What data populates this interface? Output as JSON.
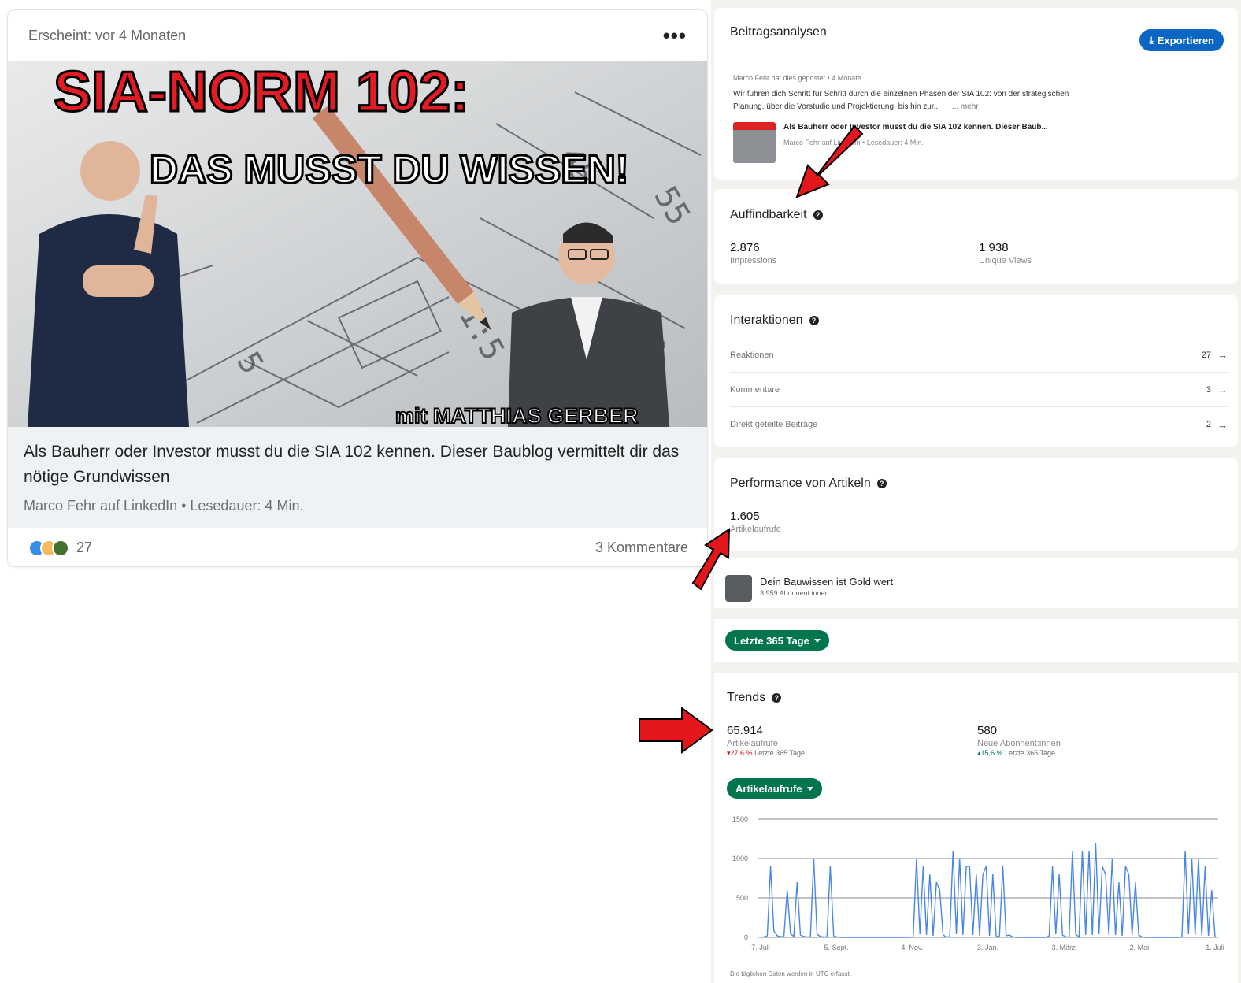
{
  "post": {
    "meta": "Erscheint: vor 4 Monaten",
    "more_label": "•••",
    "image": {
      "headline": "SIA-NORM 102:",
      "subheadline": "DAS MUSST DU WISSEN!",
      "byline": "mit MATTHIAS GERBER"
    },
    "title": "Als Bauherr oder Investor musst du die SIA 102 kennen. Dieser Baublog vermittelt dir das nötige Grundwissen",
    "source": "Marco Fehr auf LinkedIn • Lesedauer: 4 Min.",
    "reactions_count": "27",
    "comments": "3 Kommentare"
  },
  "analytics": {
    "title": "Beitragsanalysen",
    "export_label": "Exportieren",
    "preview": {
      "author_line": "Marco Fehr hat dies gepostet • 4 Monate",
      "text": "Wir führen dich Schritt für Schritt durch die einzelnen Phasen der SIA 102: von der strategischen Planung, über die Vorstudie und Projektierung, bis hin zur...",
      "more": "... mehr",
      "article_title": "Als Bauherr oder Investor musst du die SIA 102 kennen. Dieser Baub...",
      "article_meta": "Marco Fehr auf LinkedIn • Lesedauer: 4 Min."
    },
    "discoverability": {
      "title": "Auffindbarkeit",
      "impressions_value": "2.876",
      "impressions_label": "Impressions",
      "unique_value": "1.938",
      "unique_label": "Unique Views"
    },
    "interactions": {
      "title": "Interaktionen",
      "rows": [
        {
          "label": "Reaktionen",
          "value": "27"
        },
        {
          "label": "Kommentare",
          "value": "3"
        },
        {
          "label": "Direkt geteilte Beiträge",
          "value": "2"
        }
      ]
    },
    "performance": {
      "title": "Performance von Artikeln",
      "value": "1.605",
      "label": "Artikelaufrufe"
    },
    "newsletter": {
      "name": "Dein Bauwissen ist Gold wert",
      "subscribers": "3.959 Abonnent:innen"
    },
    "range_label": "Letzte 365 Tage",
    "trends": {
      "title": "Trends",
      "views_value": "65.914",
      "views_label": "Artikelaufrufe",
      "views_change": "27,6 %",
      "views_change_dir": "down",
      "views_change_period": "Letzte 365 Tage",
      "subs_value": "580",
      "subs_label": "Neue Abonnent:innen",
      "subs_change": "15,6 %",
      "subs_change_dir": "up",
      "subs_change_period": "Letzte 365 Tage",
      "metric_label": "Artikelaufrufe",
      "footnote": "Die täglichen Daten werden in UTC erfasst."
    },
    "colors": {
      "accent_blue": "#0a66c2",
      "accent_green": "#01754f",
      "down_red": "#cc1016",
      "up_green": "#057642",
      "line_blue": "#4a86e8",
      "arrow_red": "#e3161b"
    }
  },
  "chart_data": {
    "type": "line",
    "series": [
      {
        "values": [
          0,
          5,
          20,
          900,
          80,
          20,
          10,
          5,
          600,
          50,
          10,
          700,
          30,
          10,
          5,
          5,
          1000,
          40,
          10,
          5,
          5,
          900,
          20,
          5,
          0,
          0,
          0,
          0,
          0,
          0,
          0,
          0,
          0,
          0,
          0,
          0,
          0,
          0,
          0,
          0,
          0,
          0,
          0,
          0,
          0,
          0,
          5,
          1000,
          40,
          900,
          30,
          800,
          20,
          700,
          600,
          30,
          5,
          5,
          1100,
          40,
          1000,
          30,
          900,
          900,
          30,
          800,
          20,
          800,
          900,
          20,
          800,
          20,
          5,
          900,
          20,
          30,
          5,
          0,
          0,
          0,
          0,
          0,
          0,
          0,
          0,
          0,
          0,
          20,
          900,
          40,
          800,
          30,
          5,
          5,
          1100,
          40,
          5,
          1100,
          30,
          1100,
          30,
          1200,
          40,
          900,
          800,
          30,
          1000,
          30,
          700,
          20,
          900,
          800,
          30,
          700,
          30,
          5,
          0,
          0,
          0,
          0,
          0,
          0,
          0,
          0,
          0,
          0,
          0,
          5,
          1100,
          40,
          1000,
          30,
          1000,
          20,
          900,
          20,
          600,
          5
        ]
      }
    ],
    "x_tick_labels": [
      "7. Juli",
      "5. Sept.",
      "4. Nov.",
      "3. Jan.",
      "3. März",
      "2. Mai",
      "1. Juli"
    ],
    "y_tick_labels": [
      "1500",
      "1000",
      "500",
      "0"
    ],
    "ylim": [
      0,
      1500
    ],
    "grid": true
  }
}
